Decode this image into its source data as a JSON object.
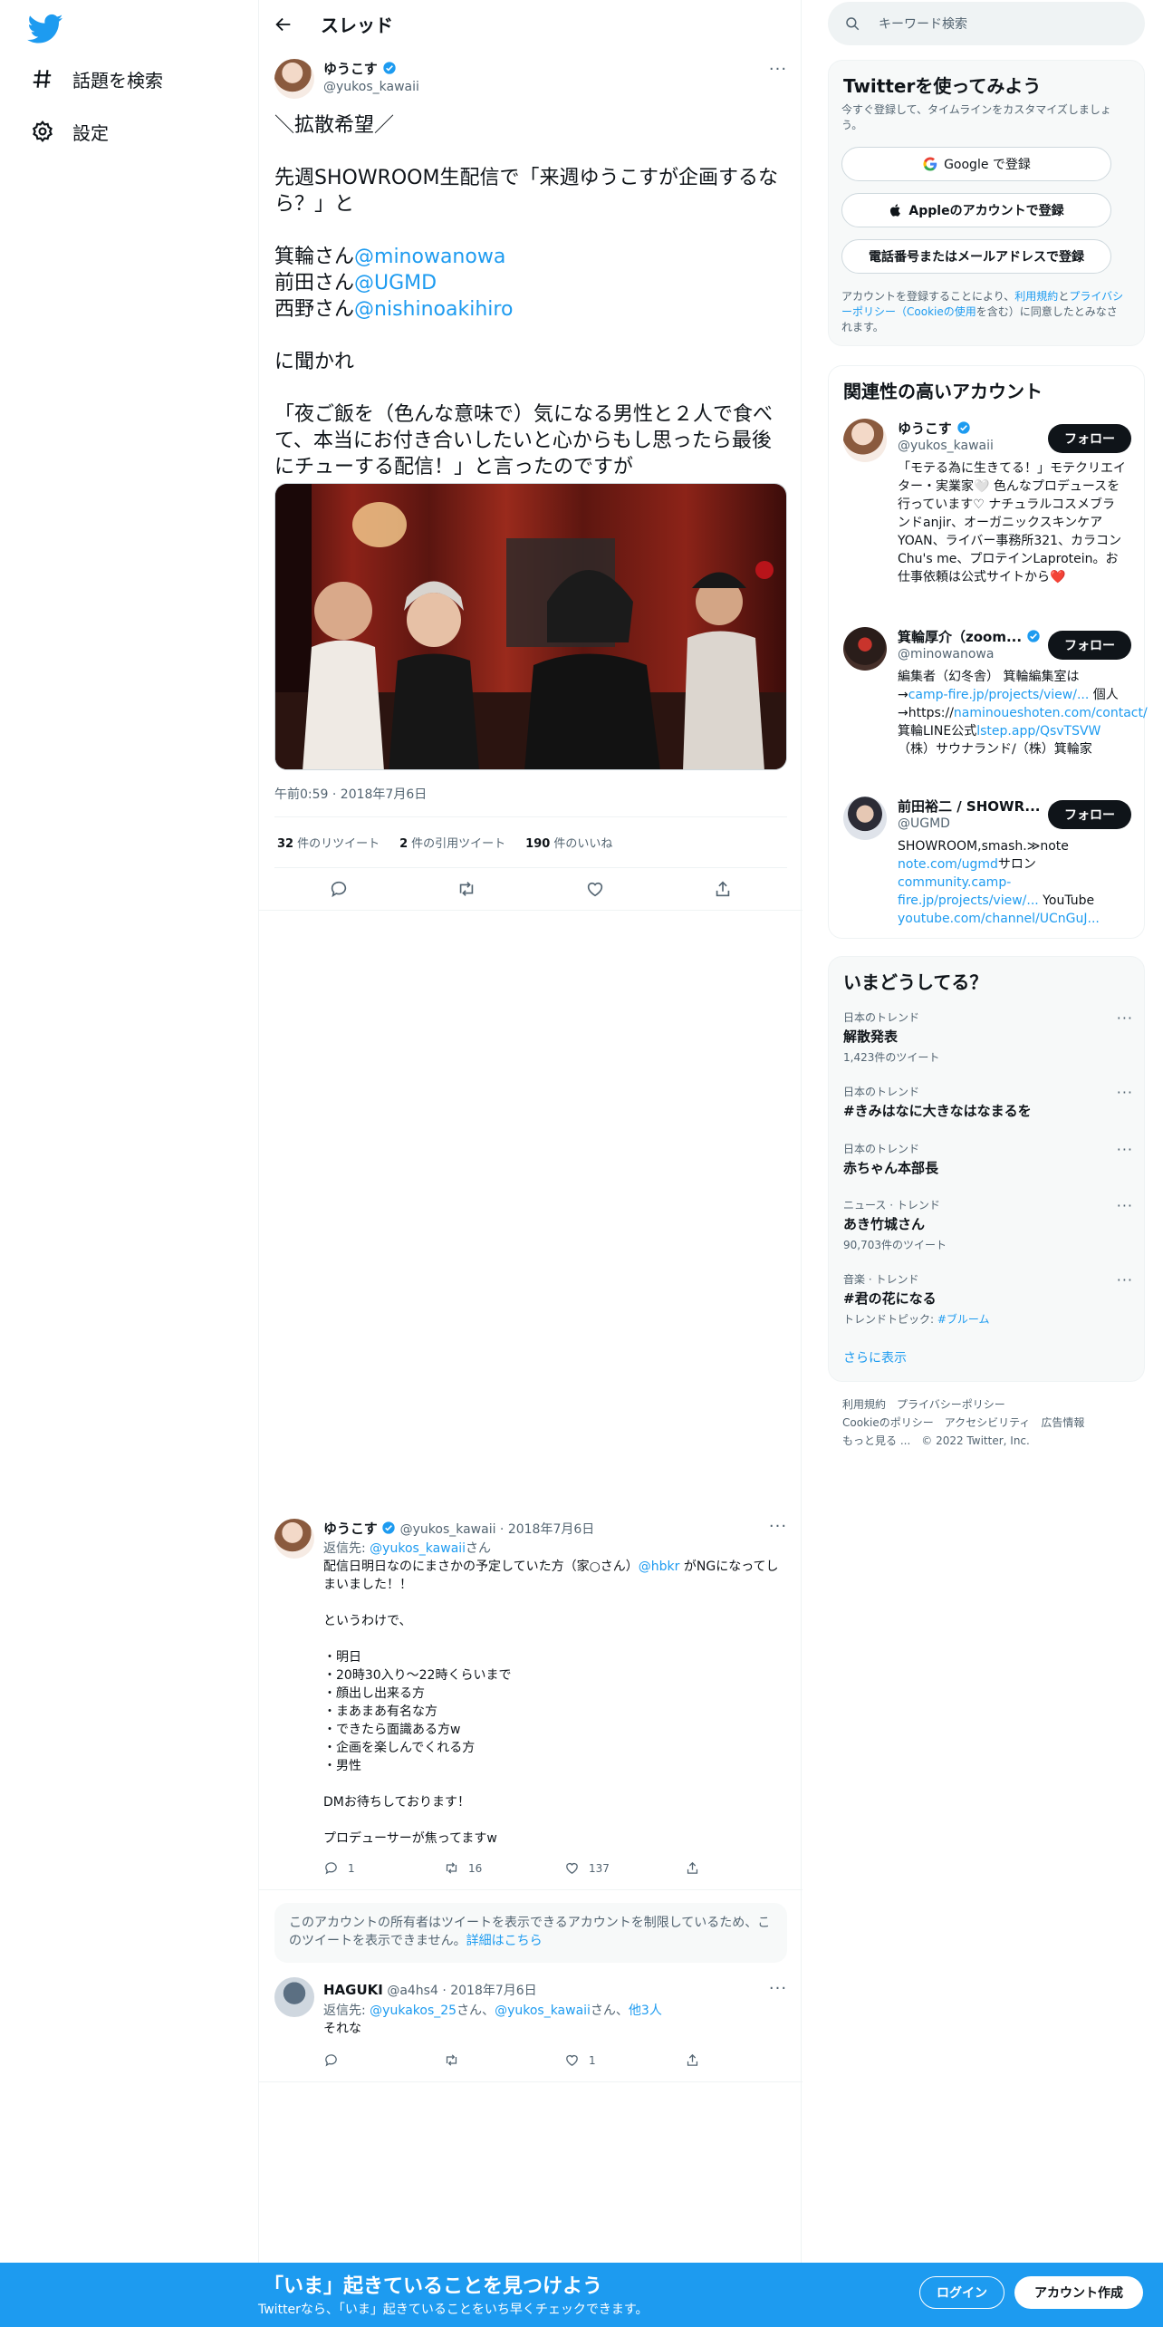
{
  "nav": {
    "explore_label": "話題を検索",
    "settings_label": "設定"
  },
  "thread": {
    "header_title": "スレッド",
    "main_tweet": {
      "display_name": "ゆうこす",
      "handle": "@yukos_kawaii",
      "text_intro": "＼拡散希望／\n\n先週SHOWROOM生配信で「来週ゆうこすが企画するなら？」と\n\n",
      "mention1_prefix": "箕輪さん",
      "mention1": "@minowanowa",
      "mention2_prefix": "前田さん",
      "mention2": "@UGMD",
      "mention3_prefix": "西野さん",
      "mention3": "@nishinoakihiro",
      "text_outro": "\n\nに聞かれ\n\n「夜ご飯を（色んな意味で）気になる男性と２人で食べて、本当にお付き合いしたいと心からもし思ったら最後にチューする配信！」と言ったのですが",
      "timestamp": "午前0:59 · 2018年7月6日",
      "retweets_count": "32",
      "retweets_label": "件のリツイート",
      "quotes_count": "2",
      "quotes_label": "件の引用ツイート",
      "likes_count": "190",
      "likes_label": "件のいいね"
    },
    "reply1": {
      "display_name": "ゆうこす",
      "handle_date": "@yukos_kawaii · 2018年7月6日",
      "reply_to_label": "返信先: ",
      "reply_to_handle": "@yukos_kawaii",
      "reply_to_suffix": "さん",
      "text_a": "配信日明日なのにまさかの予定していた方（家○さん）",
      "text_mention": "@hbkr",
      "text_b": " がNGになってしまいました！！\n\nというわけで、\n\n・明日\n・20時30入り〜22時くらいまで\n・顔出し出来る方\n・まあまあ有名な方\n・できたら面識ある方w\n・企画を楽しんでくれる方\n・男性\n\nDMお待ちしております！\n\nプロデューサーが焦ってますw",
      "replies": "1",
      "retweets": "16",
      "likes": "137"
    },
    "notice": {
      "text": "このアカウントの所有者はツイートを表示できるアカウントを制限しているため、このツイートを表示できません。",
      "link": "詳細はこちら"
    },
    "reply2": {
      "display_name": "HAGUKI",
      "handle_date": "@a4hs4 · 2018年7月6日",
      "reply_to_label": "返信先: ",
      "reply_to_handle1": "@yukakos_25",
      "reply_to_mid": "さん、",
      "reply_to_handle2": "@yukos_kawaii",
      "reply_to_mid2": "さん、",
      "reply_to_others": "他3人",
      "text": "それな",
      "likes": "1"
    }
  },
  "sidebar": {
    "search_placeholder": "キーワード検索",
    "signup_panel": {
      "title": "Twitterを使ってみよう",
      "subtitle": "今すぐ登録して、タイムラインをカスタマイズしましょう。",
      "google_btn": "Google で登録",
      "apple_btn": "Appleのアカウントで登録",
      "phone_btn": "電話番号またはメールアドレスで登録",
      "terms_a": "アカウントを登録することにより、",
      "terms_link1": "利用規約",
      "terms_b": "と",
      "terms_link2": "プライバシーポリシー（Cookieの使用",
      "terms_c": "を含む）に同意したとみなされます。"
    },
    "related": {
      "title": "関連性の高いアカウント",
      "follow_label": "フォロー",
      "accounts": [
        {
          "name": "ゆうこす",
          "handle": "@yukos_kawaii",
          "bio": "「モテる為に生きてる！」モテクリエイター・実業家🤍 色んなプロデュースを行っています♡ ナチュラルコスメブランドanjir、オーガニックスキンケアYOAN、ライバー事務所321、カラコンChu's me、プロテインLaprotein。お仕事依頼は公式サイトから❤️"
        },
        {
          "name": "箕輪厚介（zoom...",
          "handle": "@minowanowa",
          "bio_a": "編集者（幻冬舎） 箕輪編集室は→",
          "bio_link1": "camp-fire.jp/projects/view/...",
          "bio_b": " 個人→https://",
          "bio_link2": "naminoueshoten.com/contact/",
          "bio_c": " 箕輪LINE公式",
          "bio_link3": "lstep.app/QsvTSVW",
          "bio_d": "（株）サウナランド/（株）箕輪家"
        },
        {
          "name": "前田裕二 / SHOWR...",
          "handle": "@UGMD",
          "bio_a": "SHOWROOM,smash.≫note ",
          "bio_link1": "note.com/ugmd",
          "bio_b": "サロン",
          "bio_link2": "community.camp-fire.jp/projects/view/...",
          "bio_c": " YouTube ",
          "bio_link3": "youtube.com/channel/UCnGuJ..."
        }
      ]
    },
    "trends": {
      "title": "いまどうしてる？",
      "items": [
        {
          "context": "日本のトレンド",
          "name": "解散発表",
          "count": "1,423件のツイート"
        },
        {
          "context": "日本のトレンド",
          "name": "#きみはなに大きなはなまるを",
          "count": ""
        },
        {
          "context": "日本のトレンド",
          "name": "赤ちゃん本部長",
          "count": ""
        },
        {
          "context": "ニュース · トレンド",
          "name": "あき竹城さん",
          "count": "90,703件のツイート"
        },
        {
          "context": "音楽 · トレンド",
          "name": "#君の花になる",
          "count": "トレンドトピック: ",
          "count_link": "#ブルーム"
        }
      ],
      "show_more": "さらに表示"
    },
    "footer": {
      "terms": "利用規約",
      "privacy": "プライバシーポリシー",
      "cookie": "Cookieのポリシー",
      "accessibility": "アクセシビリティ",
      "ads": "広告情報",
      "more": "もっと見る ...",
      "copyright": "© 2022 Twitter, Inc."
    }
  },
  "bottom_bar": {
    "title": "「いま」起きていることを見つけよう",
    "subtitle": "Twitterなら、「いま」起きていることをいち早くチェックできます。",
    "login": "ログイン",
    "signup": "アカウント作成"
  },
  "colors": {
    "brand_blue": "#1d9bf0",
    "text": "#0f1419",
    "muted": "#536471"
  }
}
